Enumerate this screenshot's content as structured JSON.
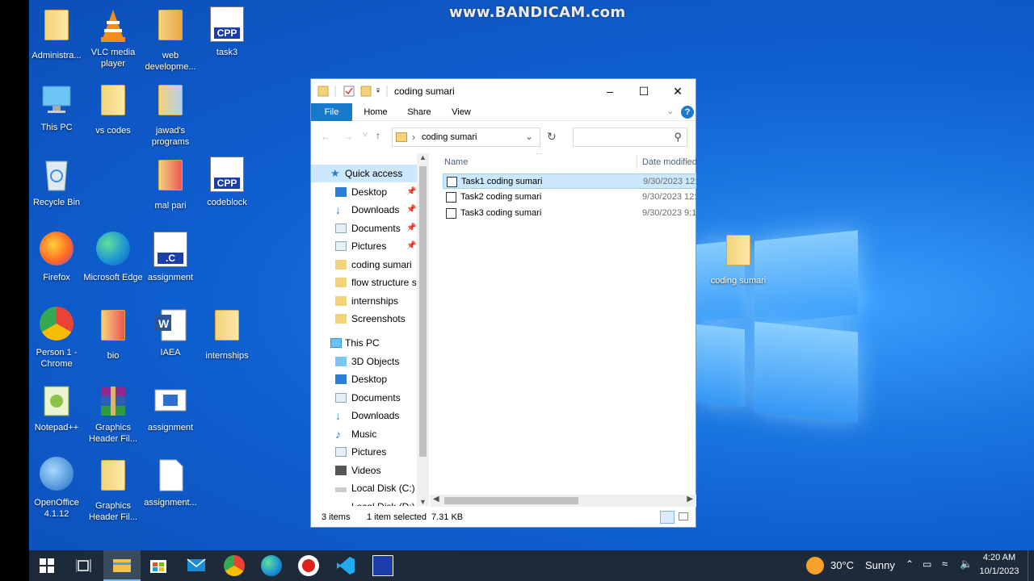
{
  "watermark": "www.BANDICAM.com",
  "desktop_icons": [
    {
      "label": "Administra...",
      "type": "folder-user"
    },
    {
      "label": "VLC media player",
      "type": "vlc"
    },
    {
      "label": "web developme...",
      "type": "folder-chrome"
    },
    {
      "label": "task3",
      "type": "cpp"
    },
    {
      "label": "This PC",
      "type": "pc"
    },
    {
      "label": "vs codes",
      "type": "folder"
    },
    {
      "label": "jawad's programs",
      "type": "folder-doc"
    },
    {
      "label": "Recycle Bin",
      "type": "recycle"
    },
    {
      "label": "mal pari",
      "type": "folder-pdf"
    },
    {
      "label": "codeblock",
      "type": "cpp"
    },
    {
      "label": "Firefox",
      "type": "firefox"
    },
    {
      "label": "Microsoft Edge",
      "type": "edge"
    },
    {
      "label": "assignment",
      "type": "c"
    },
    {
      "label": "Person 1 - Chrome",
      "type": "chrome"
    },
    {
      "label": "bio",
      "type": "folder-pdf"
    },
    {
      "label": "IAEA",
      "type": "word"
    },
    {
      "label": "internships",
      "type": "folder"
    },
    {
      "label": "Notepad++",
      "type": "notepadpp"
    },
    {
      "label": "Graphics Header Fil...",
      "type": "winrar"
    },
    {
      "label": "assignment",
      "type": "image"
    },
    {
      "label": "OpenOffice 4.1.12",
      "type": "openoffice"
    },
    {
      "label": "Graphics Header Fil...",
      "type": "folder"
    },
    {
      "label": "assignment...",
      "type": "file"
    },
    {
      "label": "coding sumari",
      "type": "folder"
    }
  ],
  "explorer": {
    "title": "coding sumari",
    "ribbon_tabs": [
      "File",
      "Home",
      "Share",
      "View"
    ],
    "address": "coding sumari",
    "search_placeholder": "",
    "columns": {
      "name": "Name",
      "date": "Date modified"
    },
    "nav": {
      "quick_access": "Quick access",
      "quick_items": [
        "Desktop",
        "Downloads",
        "Documents",
        "Pictures",
        "coding sumari",
        "flow structure sc",
        "internships",
        "Screenshots"
      ],
      "this_pc": "This PC",
      "pc_items": [
        "3D Objects",
        "Desktop",
        "Documents",
        "Downloads",
        "Music",
        "Pictures",
        "Videos",
        "Local Disk (C:)",
        "Local Disk (D:)"
      ]
    },
    "files": [
      {
        "name": "Task1 coding sumari",
        "date": "9/30/2023 12:",
        "selected": true
      },
      {
        "name": "Task2 coding sumari",
        "date": "9/30/2023 12:",
        "selected": false
      },
      {
        "name": "Task3 coding sumari",
        "date": "9/30/2023 9:1",
        "selected": false
      }
    ],
    "status": {
      "count": "3 items",
      "selected": "1 item selected",
      "size": "7.31 KB"
    }
  },
  "taskbar": {
    "weather_temp": "30°C",
    "weather_text": "Sunny",
    "time": "4:20 AM",
    "date": "10/1/2023"
  }
}
